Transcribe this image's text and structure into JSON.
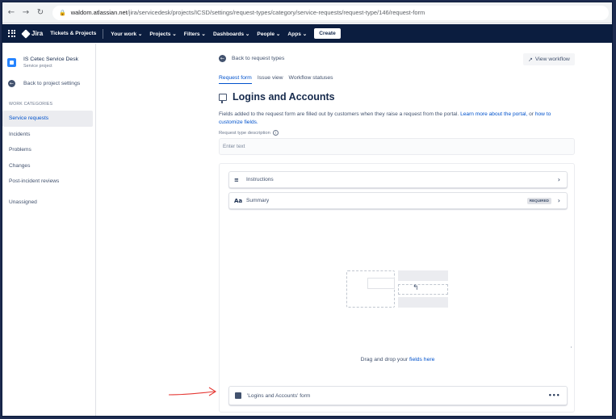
{
  "browser": {
    "url_host": "waldom.atlassian.net",
    "url_path": "/jira/servicedesk/projects/ICSD/settings/request-types/category/service-requests/request-type/146/request-form"
  },
  "topnav": {
    "logo": "Jira",
    "items": [
      "Tickets & Projects",
      "Your work ⌄",
      "Projects ⌄",
      "Filters ⌄",
      "Dashboards ⌄",
      "People ⌄",
      "Apps ⌄"
    ],
    "create": "Create"
  },
  "sidebar": {
    "project_name": "IS Cetec Service Desk",
    "project_type": "Service project",
    "back": "Back to project settings",
    "section": "WORK CATEGORIES",
    "items": [
      "Service requests",
      "Incidents",
      "Problems",
      "Changes",
      "Post-incident reviews"
    ],
    "unassigned": "Unassigned"
  },
  "main": {
    "back": "Back to request types",
    "view_workflow": "View workflow",
    "tabs": [
      "Request form",
      "Issue view",
      "Workflow statuses"
    ],
    "title": "Logins and Accounts",
    "desc_text": "Fields added to the request form are filled out by customers when they raise a request from the portal. ",
    "desc_link1": "Learn more about the portal,",
    "desc_or": " or ",
    "desc_link2": "how to customize fields.",
    "rt_label": "Request type description",
    "rt_placeholder": "Enter text",
    "fields": [
      {
        "label": "Instructions"
      },
      {
        "label": "Summary",
        "badge": "REQUIRED"
      }
    ],
    "drop_text_1": "Drag and drop your ",
    "drop_text_link": "fields here",
    "form_field": "'Logins and Accounts' form",
    "more": "•••"
  },
  "colors": {
    "topnav": "#0b1d3f",
    "accent": "#0052cc",
    "annotation_arrow": "#e53935"
  }
}
